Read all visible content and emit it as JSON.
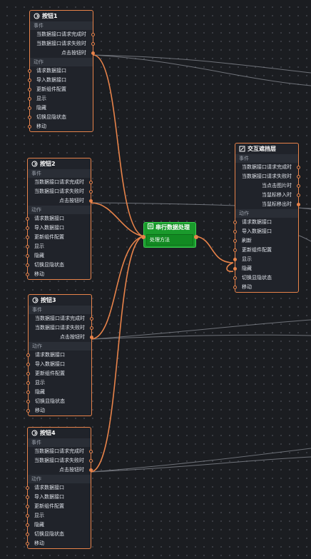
{
  "accent": "#e8834a",
  "process_color": "#1a9a2c",
  "nodes": [
    {
      "title": "按钮1",
      "icon": "button-icon",
      "event_section": "事件",
      "events": [
        "当数据接口请求完成时",
        "当数据接口请求失败时",
        "点击按钮时"
      ],
      "action_section": "动作",
      "actions": [
        "请求数据接口",
        "导入数据接口",
        "更新组件配置",
        "显示",
        "隐藏",
        "切换显隐状态",
        "移动"
      ]
    },
    {
      "title": "按钮2",
      "icon": "button-icon",
      "event_section": "事件",
      "events": [
        "当数据接口请求完成时",
        "当数据接口请求失败时",
        "点击按钮时"
      ],
      "action_section": "动作",
      "actions": [
        "请求数据接口",
        "导入数据接口",
        "更新组件配置",
        "显示",
        "隐藏",
        "切换显隐状态",
        "移动"
      ]
    },
    {
      "title": "按钮3",
      "icon": "button-icon",
      "event_section": "事件",
      "events": [
        "当数据接口请求完成时",
        "当数据接口请求失败时",
        "点击按钮时"
      ],
      "action_section": "动作",
      "actions": [
        "请求数据接口",
        "导入数据接口",
        "更新组件配置",
        "显示",
        "隐藏",
        "切换显隐状态",
        "移动"
      ]
    },
    {
      "title": "按钮4",
      "icon": "button-icon",
      "event_section": "事件",
      "events": [
        "当数据接口请求完成时",
        "当数据接口请求失败时",
        "点击按钮时"
      ],
      "action_section": "动作",
      "actions": [
        "请求数据接口",
        "导入数据接口",
        "更新组件配置",
        "显示",
        "隐藏",
        "切换显隐状态",
        "移动"
      ]
    },
    {
      "title": "交互遮挡层",
      "icon": "overlay-icon",
      "event_section": "事件",
      "events": [
        "当数据接口请求完成时",
        "当数据接口请求失败时",
        "当点击图片时",
        "当鼠标移入时",
        "当鼠标移出时"
      ],
      "action_section": "动作",
      "actions": [
        "请求数据接口",
        "导入数据接口",
        "刷新",
        "更新组件配置",
        "显示",
        "隐藏",
        "切换显隐状态",
        "移动"
      ]
    }
  ],
  "processor": {
    "title": "串行数据处理",
    "icon": "list-icon",
    "method": "处理方法"
  }
}
